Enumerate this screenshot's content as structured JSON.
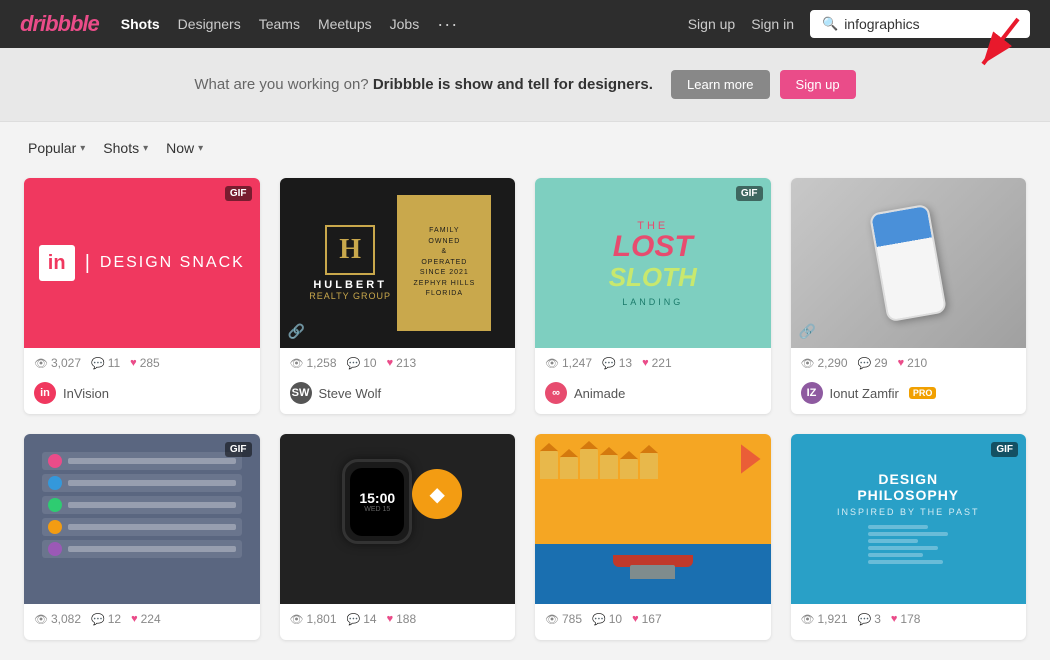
{
  "brand": {
    "logo": "dribbble",
    "logo_display": "dribbble"
  },
  "navbar": {
    "links": [
      {
        "label": "Shots",
        "active": true,
        "id": "shots"
      },
      {
        "label": "Designers",
        "active": false,
        "id": "designers"
      },
      {
        "label": "Teams",
        "active": false,
        "id": "teams"
      },
      {
        "label": "Meetups",
        "active": false,
        "id": "meetups"
      },
      {
        "label": "Jobs",
        "active": false,
        "id": "jobs"
      },
      {
        "label": "···",
        "active": false,
        "id": "more"
      }
    ],
    "right_links": [
      {
        "label": "Sign up",
        "id": "signup"
      },
      {
        "label": "Sign in",
        "id": "signin"
      }
    ],
    "search_placeholder": "infographics",
    "search_value": "infographics"
  },
  "banner": {
    "text1": "What are you working on?",
    "text2": "Dribbble is show and tell for designers.",
    "btn_learn": "Learn more",
    "btn_signup": "Sign up"
  },
  "filters": {
    "popular_label": "Popular",
    "shots_label": "Shots",
    "now_label": "Now"
  },
  "shots": [
    {
      "id": "invision",
      "type": "gif",
      "has_gif": true,
      "views": "3,027",
      "comments": "11",
      "likes": "285",
      "author": "InVision",
      "author_color": "#f0385f",
      "author_initials": "in",
      "pro": false,
      "thumb_type": "invision"
    },
    {
      "id": "hulbert",
      "type": "link",
      "has_gif": false,
      "views": "1,258",
      "comments": "10",
      "likes": "213",
      "author": "Steve Wolf",
      "author_color": "#555",
      "author_initials": "SW",
      "pro": false,
      "thumb_type": "hulbert"
    },
    {
      "id": "lostsloth",
      "type": "gif",
      "has_gif": true,
      "views": "1,247",
      "comments": "13",
      "likes": "221",
      "author": "Animade",
      "author_color": "#e74c6f",
      "author_initials": "∞",
      "pro": false,
      "thumb_type": "lostsloth"
    },
    {
      "id": "ionut",
      "type": "link",
      "has_gif": false,
      "views": "2,290",
      "comments": "29",
      "likes": "210",
      "author": "Ionut Zamfir",
      "author_color": "#8e5aa0",
      "author_initials": "IZ",
      "pro": true,
      "thumb_type": "ionut"
    },
    {
      "id": "darkui",
      "type": "gif",
      "has_gif": true,
      "views": "3,082",
      "comments": "12",
      "likes": "224",
      "author": "",
      "author_color": "#555",
      "author_initials": "",
      "pro": false,
      "thumb_type": "darkui"
    },
    {
      "id": "applewatch",
      "type": "normal",
      "has_gif": false,
      "views": "1,801",
      "comments": "14",
      "likes": "188",
      "author": "",
      "author_color": "#555",
      "author_initials": "",
      "pro": false,
      "thumb_type": "applewatch"
    },
    {
      "id": "boat",
      "type": "normal",
      "has_gif": false,
      "views": "785",
      "comments": "10",
      "likes": "167",
      "author": "",
      "author_color": "#555",
      "author_initials": "",
      "pro": false,
      "thumb_type": "boat"
    },
    {
      "id": "designphil",
      "type": "gif",
      "has_gif": true,
      "views": "1,921",
      "comments": "3",
      "likes": "178",
      "author": "",
      "author_color": "#555",
      "author_initials": "",
      "pro": false,
      "thumb_type": "designphil"
    }
  ],
  "icons": {
    "eye": "👁",
    "comment": "💬",
    "heart": "♥",
    "search": "🔍",
    "link": "🔗"
  },
  "pro_label": "PRO"
}
